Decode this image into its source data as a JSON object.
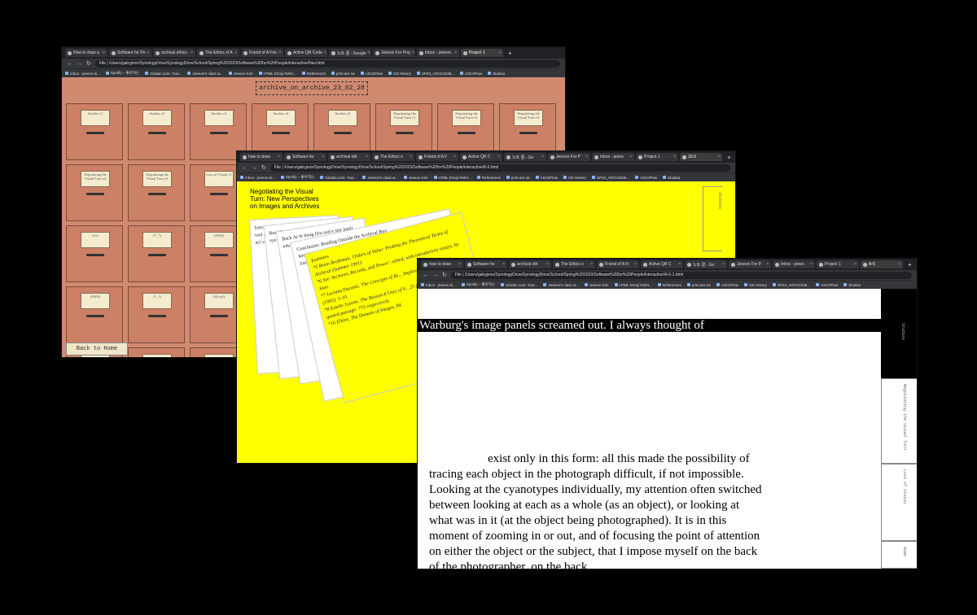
{
  "windows": {
    "nav": {
      "tabs": [
        "How to draw a",
        "Software for Pe",
        "archival ethics",
        "The Ethics of A",
        "Friend of A Frie",
        "Active QR Code",
        "노트 클 - Google",
        "Jeeeon For Proj",
        "Inbox - jeeeon.",
        "Project 1"
      ],
      "url": "/Users/gabyjenn/SynologyDrive/SynologyDrive/School/Spring%202023/Software%20for%20People/interactive/Nav.html",
      "url_prefix": "File",
      "bookmarks": [
        "Inbox - jeeeon.ki...",
        "Spotify – 좋아하는",
        "Glodan.com: Your...",
        "Jeeeon's class w...",
        "Jeeeon Kim",
        "HTML Emoji Refer...",
        "References",
        "print.are.na",
        "ASCIIFlow",
        "GD History",
        "SP23_ARCH2236...",
        "ASCIIFlow",
        "Studios"
      ],
      "archive_title": "archive_on_archive_23_02_28",
      "drawers": [
        "Studies v1",
        "Studies v2",
        "Studies v3",
        "Studies v4",
        "Studies v5",
        "Negotiating the Visual Turn v1",
        "Negotiating the Visual Turn v2",
        "Negotiating the Visual Turn v3",
        "Negotiating the Visual Turn v4",
        "Negotiating the Visual Turn v5",
        "Loss of Visual v1",
        "",
        "",
        "",
        "",
        "",
        "(•i•)",
        "(*_*)",
        "(0W0)",
        "",
        "",
        "",
        "",
        "",
        "(0W0)",
        "(1_1)",
        "(@w@)",
        "",
        "",
        "",
        "",
        "",
        "",
        "",
        "",
        "",
        "",
        "",
        "",
        ""
      ],
      "back_home": "Back to Home"
    },
    "studies": {
      "tabs": [
        "how to draw",
        "Software for",
        "archival eth",
        "The Ethics o",
        "Friend of A F",
        "Active QR C",
        "노트 클 - Go",
        "Jeeeon For P",
        "Inbox - jeeeo",
        "Project 1",
        "15-5"
      ],
      "url": "/Users/gabyjenn/SynologyDrive/SynologyDrive/School/Spring%202023/Software%20for%20People/interactive/8-5.html",
      "url_prefix": "File",
      "bookmarks": [
        "Inbox - jeeeon.ki...",
        "Spotify – 좋아하는",
        "Glodan.com: Your...",
        "Jeeeon's class w...",
        "Jeeeon Kim",
        "HTML Emoji Refer...",
        "References",
        "print.are.na",
        "ASCIIFlow",
        "GD History",
        "SP23_ARCH2236...",
        "ASCIIFlow",
        "Studios"
      ],
      "title_lines": [
        "Negotiating the Visual",
        "Turn: New Perspectives",
        "on Images and Archives"
      ],
      "side_tab": "Studies",
      "paper_intro": "Intro As a with imag way. Met visu. Mai tool atte dic rele imp gat be bac clu ap e aci ve",
      "paper_read": "Read Beca mea visu Ima [for wer and eye the 'the 'cri ref cla th th",
      "paper_back": "Back At th Imag [fro and e stre instit edu pul tra ev",
      "paper_concl_title": "Conclusion: Reading Outside the Archival Box",
      "paper_concl_body": "Writing about the profile of visual archival, relating to archives that are 'de lineate' ... easily ... visual ... of c ... ever call ... thi lear dis ing ... the ha th",
      "footnotes_title": "footnotes",
      "footnotes": [
        "*5 Brien Brothman, 'Orders of Value: Probing the Theoretical Terms of Archival (Summer 1991)",
        "*6 See 'Archives, Records, and Power', edited, with introductory essays, by Joan",
        "*7 Luciana Duranti, 'The Concepts of Re... Implications,' Archivaria 39 (1995): 5-10.",
        "*8 Estelle Jussim, 'The Research Uses of V... 25 (April 1977): 763-78. The quoted passage: 775 respectively.",
        "*16 Elkins, The Domain of Images, 84."
      ]
    },
    "warburg": {
      "tabs": [
        "how to draw",
        "Software for",
        "archival eth",
        "The Ethics o",
        "Friend of A Fr",
        "Active QR C",
        "노트 클 - Go",
        "Jeeeon For P",
        "Inbox - jeeeo",
        "Project 1",
        "A-5"
      ],
      "url": "/Users/gabyjenn/SynologyDrive/SynologyDrive/School/Spring%202023/Software%20for%20People/interactive/A-5-1.html",
      "url_prefix": "File",
      "bookmarks": [
        "Inbox - jeeeon.ki...",
        "Spotify – 좋아하는",
        "Glodan.com: Your...",
        "Jeeeon's class w...",
        "Jeeeon Kim",
        "HTML Emoji Refer...",
        "References",
        "print.are.na",
        "ASCIIFlow",
        "GD History",
        "SP23_ARCH2236...",
        "ASCIIFlow",
        "Studios"
      ],
      "headline": "Warburg's image panels screamed out. I always thought of",
      "body_lines": [
        "exist only in this form: all this made the possibility of",
        "tracing each object in the photograph difficult, if not impossible.",
        "Looking at the cyanotypes individually, my attention often switched",
        "between looking at each as a whole (as an object), or looking at",
        "what was in it (at the object being photographed). It is in this",
        "moment of zooming in or out, and of focusing the point of attention",
        "on either the object or the subject, that I impose myself on the back",
        "of the photographer, on the back"
      ],
      "side_tabs": [
        "Studies",
        "Negotiating the Visual Turn",
        "Loss of Vision",
        "Home"
      ]
    }
  }
}
